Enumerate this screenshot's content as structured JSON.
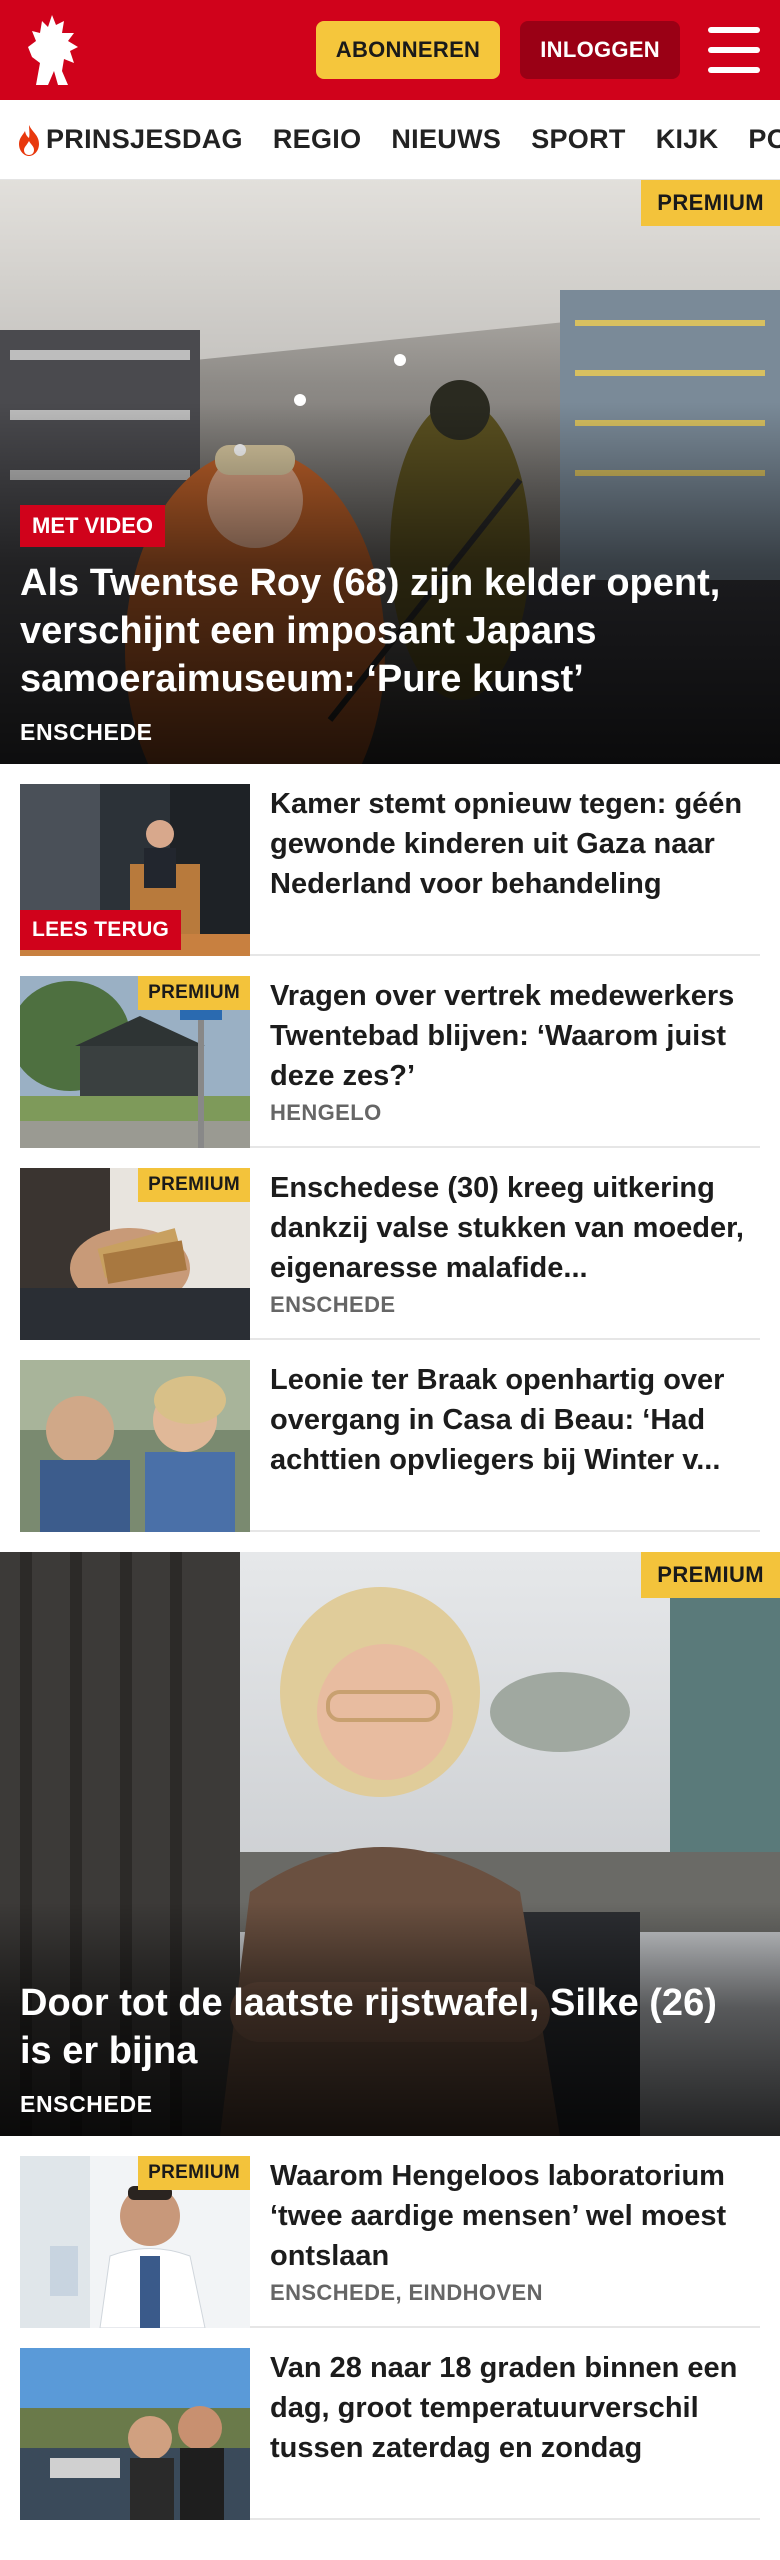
{
  "header": {
    "subscribe_label": "ABONNEREN",
    "login_label": "INLOGGEN",
    "menu_icon": "hamburger-menu-icon",
    "logo_icon": "tubantia-horse-logo"
  },
  "nav": {
    "items": [
      {
        "label": "PRINSJESDAG",
        "icon": "flame-icon"
      },
      {
        "label": "REGIO"
      },
      {
        "label": "NIEUWS"
      },
      {
        "label": "SPORT"
      },
      {
        "label": "KIJK"
      },
      {
        "label": "PODCA"
      }
    ]
  },
  "hero1": {
    "badge": "PREMIUM",
    "tag": "MET VIDEO",
    "title": "Als Twentse Roy (68) zijn kelder opent, verschijnt een imposant Japans samoeraimuseum: ‘Pure kunst’",
    "location": "ENSCHEDE"
  },
  "list1": [
    {
      "tag": "LEES TERUG",
      "title": "Kamer stemt opnieuw tegen: géén gewonde kinderen uit Gaza naar Nederland voor behandeling",
      "location": ""
    },
    {
      "badge": "PREMIUM",
      "title": "Vragen over vertrek medewer­kers Twentebad blijven: ‘Waarom juist deze zes?’",
      "location": "HENGELO"
    },
    {
      "badge": "PREMIUM",
      "title": "Enschedese (30) kreeg uitkering dankzij valse stukken van moeder, eigenaresse malafide...",
      "location": "ENSCHEDE"
    },
    {
      "title": "Leonie ter Braak openhartig over overgang in Casa di Beau: ‘Had achttien opvliegers bij Winter v...",
      "location": ""
    }
  ],
  "hero2": {
    "badge": "PREMIUM",
    "title": "Door tot de laatste rijstwafel, Silke (26) is er bijna",
    "location": "ENSCHEDE"
  },
  "list2": [
    {
      "badge": "PREMIUM",
      "title": "Waarom Hengeloos laboratorium ‘twee aardige mensen’ wel moest ontslaan",
      "location": "ENSCHEDE, EINDHOVEN"
    },
    {
      "title": "Van 28 naar 18 graden binnen een dag, groot temperatuurverschil tussen zaterdag en zondag",
      "location": ""
    }
  ],
  "colors": {
    "brand_red": "#d0021b",
    "premium_yellow": "#f3c33b",
    "login_dark_red": "#9a0015"
  }
}
